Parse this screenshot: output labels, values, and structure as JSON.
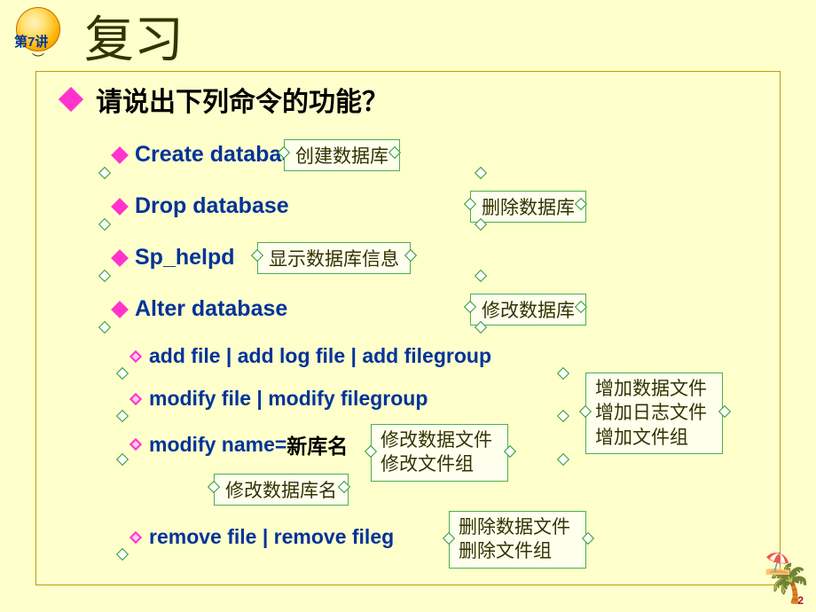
{
  "lecture": {
    "label": "第7讲"
  },
  "title": "复习",
  "main_bullet": "请说出下列命令的功能？",
  "cmds": {
    "create": "Create databas",
    "drop": "Drop database",
    "sphelp": "Sp_helpd",
    "alter": "Alter database"
  },
  "opts": {
    "add": "add file   |   add log file |   add filegroup",
    "modfile": "modify file  |  modify  filegroup",
    "modname_pre": "modify  name= ",
    "modname_cn": "新库名",
    "remove": "remove file  |  remove fileg"
  },
  "notes": {
    "create": "创建数据库",
    "drop": "删除数据库",
    "sphelp": "显示数据库信息",
    "alter": "修改数据库",
    "add_group": "增加数据文件\n增加日志文件\n增加文件组",
    "mod_group": "修改数据文件\n修改文件组",
    "rename": "修改数据库名",
    "remove_group": "删除数据文件\n删除文件组"
  },
  "page_number": "2"
}
